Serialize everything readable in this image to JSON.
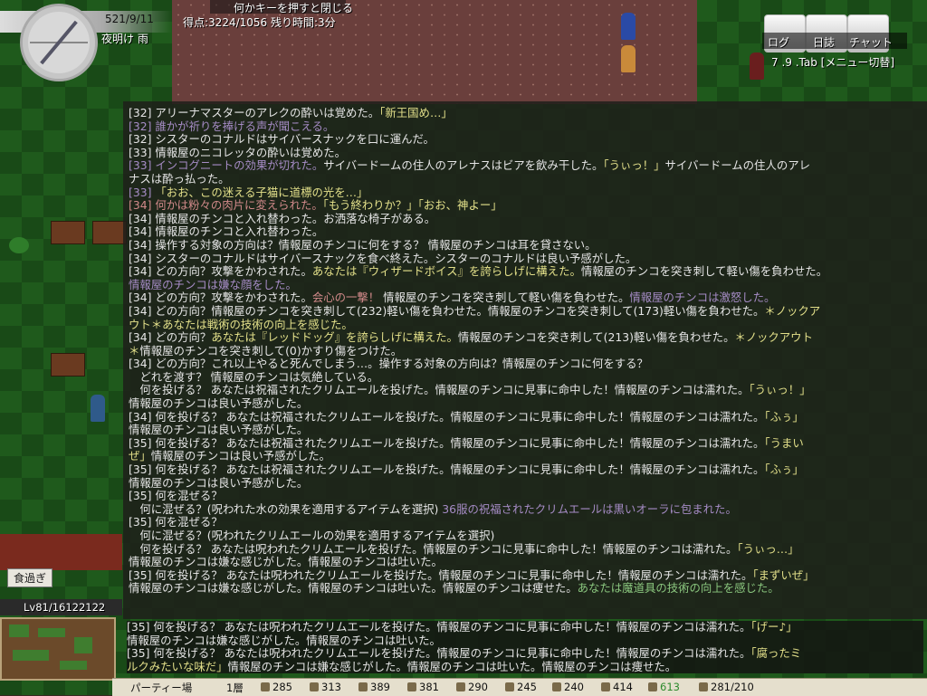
{
  "hud": {
    "date": "521/9/11",
    "time_weather": "夜明け 雨",
    "score": "得点:3224/1056 残り時間:3分",
    "notice": "何かキーを押すと閉じる",
    "menu": {
      "log": "ログ",
      "journal": "日誌",
      "chat": "チャット",
      "hint": "7 .9 .Tab [メニュー切替]"
    },
    "hunger": "食過ぎ",
    "level": "Lv81/16122122"
  },
  "colors": {
    "white": "#e6e6e6",
    "yellow": "#e3e08a",
    "purple": "#a68cc6",
    "red": "#d28a8a",
    "green": "#8bc77f"
  },
  "log": [
    [
      [
        "w",
        "[32] アリーナマスターのアレクの酔いは覚めた。"
      ],
      [
        "y",
        "「新王国め…」"
      ]
    ],
    [
      [
        "p",
        "[32] 誰かが祈りを捧げる声が聞こえる。"
      ]
    ],
    [
      [
        "w",
        "[32] シスターのコナルドはサイバースナックを口に運んだ。"
      ]
    ],
    [
      [
        "w",
        "[33] 情報屋のニコレッタの酔いは覚めた。"
      ]
    ],
    [
      [
        "p",
        "[33] インコグニートの効果が切れた。"
      ],
      [
        "w",
        "サイバードームの住人のアレナスはビアを飲み干した。"
      ],
      [
        "y",
        "「うぃっ！」"
      ],
      [
        "w",
        "サイバードームの住人のアレ"
      ]
    ],
    [
      [
        "w",
        "ナスは酔っ払った。"
      ]
    ],
    [
      [
        "p",
        "[33] "
      ],
      [
        "y",
        "「おお、この迷える子猫に道標の光を…」"
      ]
    ],
    [
      [
        "r",
        "[34] 何かは粉々の肉片に変えられた。"
      ],
      [
        "y",
        "「もう終わりか？」「おお、神よー」"
      ]
    ],
    [
      [
        "w",
        "[34] 情報屋のチンコと入れ替わった。お洒落な椅子がある。"
      ]
    ],
    [
      [
        "w",
        "[34] 情報屋のチンコと入れ替わった。"
      ]
    ],
    [
      [
        "w",
        "[34] 操作する対象の方向は？情報屋のチンコに何をする？ 情報屋のチンコは耳を貸さない。"
      ]
    ],
    [
      [
        "w",
        "[34] シスターのコナルドはサイバースナックを食べ終えた。シスターのコナルドは良い予感がした。"
      ]
    ],
    [
      [
        "w",
        "[34] どの方向？攻撃をかわされた。"
      ],
      [
        "y",
        "あなたは『ウィザードボイス』を誇らしげに構えた。"
      ],
      [
        "w",
        "情報屋のチンコを突き刺して軽い傷を負わせた。"
      ]
    ],
    [
      [
        "p",
        "情報屋のチンコは嫌な顔をした。"
      ]
    ],
    [
      [
        "w",
        "[34] どの方向？攻撃をかわされた。"
      ],
      [
        "r",
        "会心の一撃！"
      ],
      [
        "w",
        " 情報屋のチンコを突き刺して軽い傷を負わせた。"
      ],
      [
        "p",
        "情報屋のチンコは激怒した。"
      ]
    ],
    [
      [
        "w",
        "[34] どの方向？情報屋のチンコを突き刺して(232)軽い傷を負わせた。情報屋のチンコを突き刺して(173)軽い傷を負わせた。"
      ],
      [
        "y",
        "＊ノックア"
      ]
    ],
    [
      [
        "y",
        "ウト＊あなたは戦術の技術の向上を感じた。"
      ]
    ],
    [
      [
        "w",
        "[34] どの方向？"
      ],
      [
        "y",
        "あなたは『レッドドッグ』を誇らしげに構えた。"
      ],
      [
        "w",
        "情報屋のチンコを突き刺して(213)軽い傷を負わせた。"
      ],
      [
        "y",
        "＊ノックアウト"
      ]
    ],
    [
      [
        "y",
        "＊"
      ],
      [
        "w",
        "情報屋のチンコを突き刺して(0)かすり傷をつけた。"
      ]
    ],
    [
      [
        "w",
        "[34] どの方向？これ以上やると死んでしまう…。操作する対象の方向は？情報屋のチンコに何をする？"
      ]
    ],
    [
      [
        "w",
        "　どれを渡す？ 情報屋のチンコは気絶している。"
      ]
    ],
    [
      [
        "w",
        "　何を投げる？ あなたは祝福されたクリムエールを投げた。情報屋のチンコに見事に命中した！情報屋のチンコは濡れた。"
      ],
      [
        "y",
        "「うぃっ！」"
      ]
    ],
    [
      [
        "w",
        "情報屋のチンコは良い予感がした。"
      ]
    ],
    [
      [
        "w",
        "[34] 何を投げる？ あなたは祝福されたクリムエールを投げた。情報屋のチンコに見事に命中した！情報屋のチンコは濡れた。"
      ],
      [
        "y",
        "「ふぅ」"
      ]
    ],
    [
      [
        "w",
        "情報屋のチンコは良い予感がした。"
      ]
    ],
    [
      [
        "w",
        "[35] 何を投げる？ あなたは祝福されたクリムエールを投げた。情報屋のチンコに見事に命中した！情報屋のチンコは濡れた。"
      ],
      [
        "y",
        "「うまい"
      ]
    ],
    [
      [
        "y",
        "ぜ」"
      ],
      [
        "w",
        "情報屋のチンコは良い予感がした。"
      ]
    ],
    [
      [
        "w",
        "[35] 何を投げる？ あなたは祝福されたクリムエールを投げた。情報屋のチンコに見事に命中した！情報屋のチンコは濡れた。"
      ],
      [
        "y",
        "「ふぅ」"
      ]
    ],
    [
      [
        "w",
        "情報屋のチンコは良い予感がした。"
      ]
    ],
    [
      [
        "w",
        "[35] 何を混ぜる？"
      ]
    ],
    [
      [
        "w",
        "　何に混ぜる？(呪われた水の効果を適用するアイテムを選択) "
      ],
      [
        "p",
        "36服の祝福されたクリムエールは黒いオーラに包まれた。"
      ]
    ],
    [
      [
        "w",
        "[35] 何を混ぜる？"
      ]
    ],
    [
      [
        "w",
        "　何に混ぜる？(呪われたクリムエールの効果を適用するアイテムを選択)"
      ]
    ],
    [
      [
        "w",
        "　何を投げる？ あなたは呪われたクリムエールを投げた。情報屋のチンコに見事に命中した！情報屋のチンコは濡れた。"
      ],
      [
        "y",
        "「うぃっ…」"
      ]
    ],
    [
      [
        "w",
        "情報屋のチンコは嫌な感じがした。情報屋のチンコは吐いた。"
      ]
    ],
    [
      [
        "w",
        "[35] 何を投げる？ あなたは呪われたクリムエールを投げた。情報屋のチンコに見事に命中した！情報屋のチンコは濡れた。"
      ],
      [
        "y",
        "「まずいぜ」"
      ]
    ],
    [
      [
        "w",
        "情報屋のチンコは嫌な感じがした。情報屋のチンコは吐いた。情報屋のチンコは痩せた。"
      ],
      [
        "g",
        "あなたは魔道具の技術の向上を感じた。"
      ]
    ]
  ],
  "log_bottom": [
    [
      [
        "w",
        "[35] 何を投げる？ あなたは呪われたクリムエールを投げた。情報屋のチンコに見事に命中した！情報屋のチンコは濡れた。"
      ],
      [
        "y",
        "「げー♪」"
      ]
    ],
    [
      [
        "w",
        "情報屋のチンコは嫌な感じがした。情報屋のチンコは吐いた。"
      ]
    ],
    [
      [
        "w",
        "[35] 何を投げる？ あなたは呪われたクリムエールを投げた。情報屋のチンコに見事に命中した！情報屋のチンコは濡れた。"
      ],
      [
        "y",
        "「腐ったミ"
      ]
    ],
    [
      [
        "y",
        "ルクみたいな味だ」"
      ],
      [
        "w",
        "情報屋のチンコは嫌な感じがした。情報屋のチンコは吐いた。情報屋のチンコは痩せた。"
      ]
    ]
  ],
  "status": {
    "location": "パーティー場",
    "floor": "1層",
    "stats": [
      {
        "icon": "sword-icon",
        "value": "285"
      },
      {
        "icon": "dagger-icon",
        "value": "313"
      },
      {
        "icon": "axe-icon",
        "value": "389"
      },
      {
        "icon": "bow-icon",
        "value": "381"
      },
      {
        "icon": "book-icon",
        "value": "290"
      },
      {
        "icon": "scale-icon",
        "value": "245"
      },
      {
        "icon": "clock-icon",
        "value": "240"
      },
      {
        "icon": "eye-icon",
        "value": "414"
      },
      {
        "icon": "heart-icon",
        "value": "613",
        "color": "#2d8a2d"
      },
      {
        "icon": "weight-icon",
        "value": "281/210"
      }
    ]
  }
}
